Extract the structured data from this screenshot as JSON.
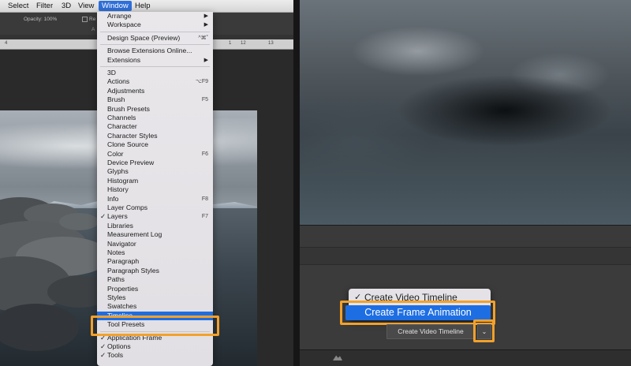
{
  "menubar": {
    "items": [
      "Select",
      "Filter",
      "3D",
      "View",
      "Window",
      "Help"
    ],
    "active": "Window"
  },
  "options_bar": {
    "opacity": "Opacity: 100%",
    "partial_label": "Re",
    "caption_fragment": "A"
  },
  "ruler": {
    "ticks": [
      "4",
      "1",
      "12",
      "13"
    ]
  },
  "window_menu": {
    "items": [
      {
        "label": "Arrange",
        "submenu": true
      },
      {
        "label": "Workspace",
        "submenu": true
      },
      {
        "sep": true
      },
      {
        "label": "Design Space (Preview)",
        "shortcut": "^⌘˚"
      },
      {
        "sep": true
      },
      {
        "label": "Browse Extensions Online..."
      },
      {
        "label": "Extensions",
        "submenu": true
      },
      {
        "sep": true
      },
      {
        "label": "3D"
      },
      {
        "label": "Actions",
        "shortcut": "⌥F9"
      },
      {
        "label": "Adjustments"
      },
      {
        "label": "Brush",
        "shortcut": "F5"
      },
      {
        "label": "Brush Presets"
      },
      {
        "label": "Channels"
      },
      {
        "label": "Character"
      },
      {
        "label": "Character Styles"
      },
      {
        "label": "Clone Source"
      },
      {
        "label": "Color",
        "shortcut": "F6"
      },
      {
        "label": "Device Preview"
      },
      {
        "label": "Glyphs"
      },
      {
        "label": "Histogram"
      },
      {
        "label": "History"
      },
      {
        "label": "Info",
        "shortcut": "F8"
      },
      {
        "label": "Layer Comps"
      },
      {
        "label": "Layers",
        "checked": true,
        "shortcut": "F7"
      },
      {
        "label": "Libraries"
      },
      {
        "label": "Measurement Log"
      },
      {
        "label": "Navigator"
      },
      {
        "label": "Notes"
      },
      {
        "label": "Paragraph"
      },
      {
        "label": "Paragraph Styles"
      },
      {
        "label": "Paths"
      },
      {
        "label": "Properties"
      },
      {
        "label": "Styles"
      },
      {
        "label": "Swatches"
      },
      {
        "label": "Timeline",
        "highlighted": true
      },
      {
        "label": "Tool Presets"
      },
      {
        "sep": true
      },
      {
        "label": "Application Frame",
        "checked": true
      },
      {
        "label": "Options",
        "checked": true
      },
      {
        "label": "Tools",
        "checked": true
      }
    ]
  },
  "timeline_popup": {
    "option_video": "Create Video Timeline",
    "option_frame": "Create Frame Animation",
    "button_label": "Create Video Timeline",
    "dropdown_glyph": "⌄",
    "checkmark": "✓"
  },
  "colors": {
    "highlight_blue": "#1e6ee3",
    "callout_orange": "#f2a12b"
  }
}
